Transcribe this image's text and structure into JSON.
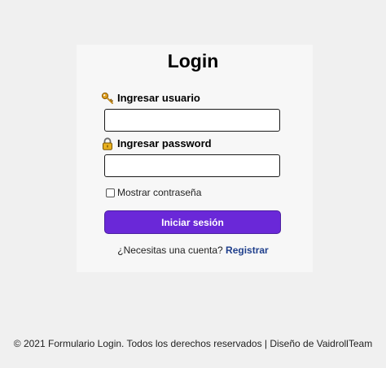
{
  "page": {
    "title": "Login",
    "background_color": "#f0f0f0",
    "card_color": "#f7f7f7"
  },
  "form": {
    "username_icon": "key-icon",
    "username_label": "Ingresar usuario",
    "username_value": "",
    "password_icon": "lock-icon",
    "password_label": "Ingresar password",
    "password_value": "",
    "show_password_label": "Mostrar contraseña",
    "show_password_checked": false,
    "submit_label": "Iniciar sesión",
    "submit_color": "#6a28d8"
  },
  "register": {
    "prompt": "¿Necesitas una cuenta?",
    "link_label": "Registrar",
    "link_color": "#1f3f8c"
  },
  "footer": {
    "text": "© 2021 Formulario Login. Todos los derechos reservados | Diseño de VaidrollTeam"
  }
}
